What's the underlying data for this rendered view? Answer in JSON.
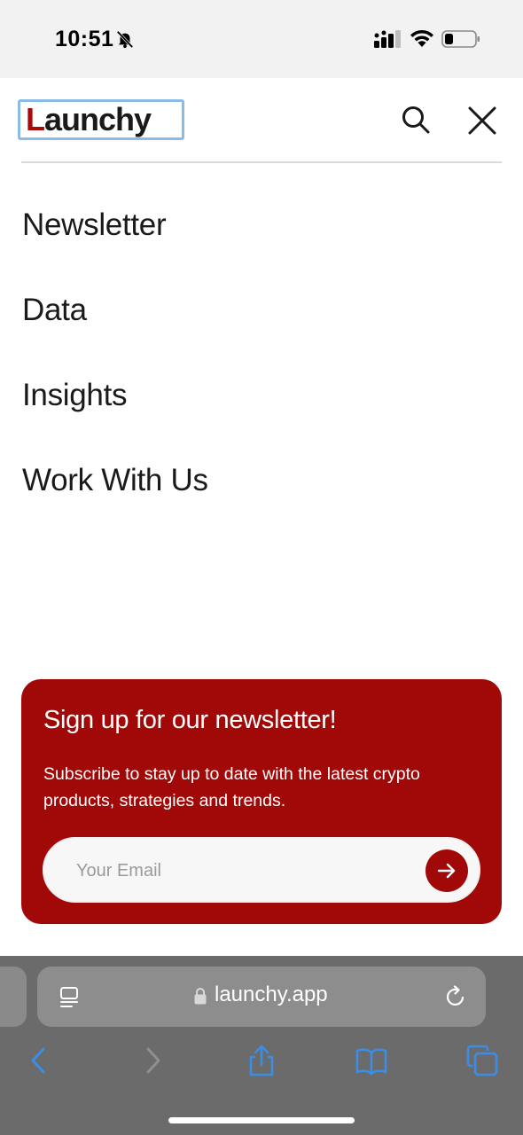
{
  "status_bar": {
    "time": "10:51"
  },
  "header": {
    "logo_first_letter": "L",
    "logo_rest": "aunchy"
  },
  "nav": {
    "items": [
      {
        "label": "Newsletter"
      },
      {
        "label": "Data"
      },
      {
        "label": "Insights"
      },
      {
        "label": "Work With Us"
      }
    ]
  },
  "newsletter": {
    "title": "Sign up for our newsletter!",
    "description": "Subscribe to stay up to date with the latest crypto products, strategies and trends.",
    "email_placeholder": "Your Email"
  },
  "browser": {
    "url": "launchy.app"
  },
  "colors": {
    "brand_red": "#a10909",
    "browser_chrome": "#6b6b6b",
    "toolbar_icon": "#3a8ee6"
  },
  "icons": [
    "bell-off-icon",
    "signal-icon",
    "wifi-icon",
    "battery-icon",
    "search-icon",
    "close-icon",
    "arrow-right-icon",
    "reader-icon",
    "lock-icon",
    "reload-icon",
    "back-icon",
    "forward-icon",
    "share-icon",
    "bookmarks-icon",
    "tabs-icon"
  ]
}
